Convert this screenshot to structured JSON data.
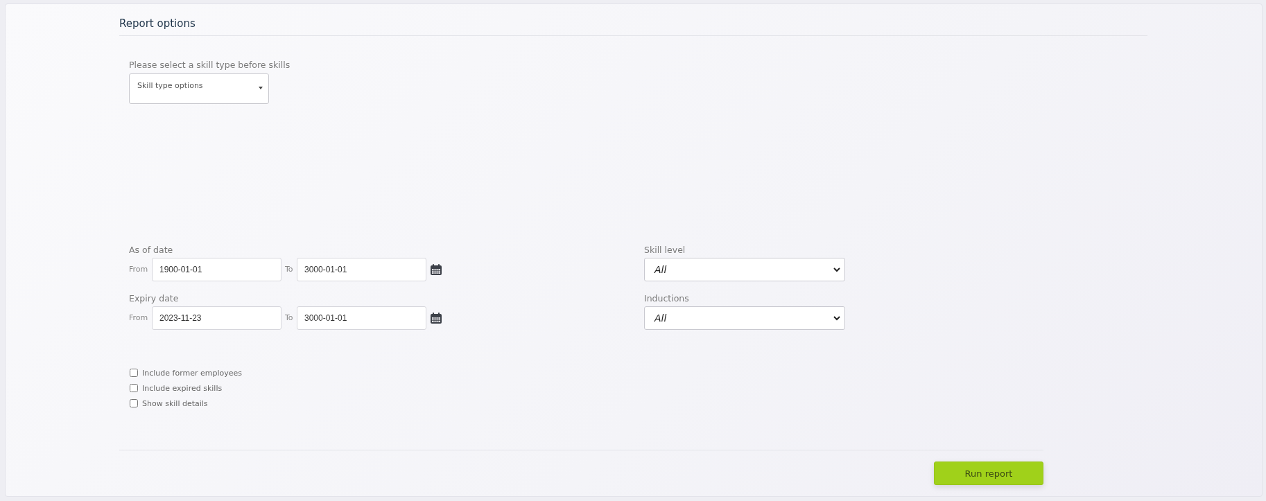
{
  "section": {
    "title": "Report options"
  },
  "skill_type": {
    "label": "Please select a skill type before skills",
    "placeholder": "Skill type options"
  },
  "date_ranges": [
    {
      "label": "As of date",
      "from_label": "From",
      "from_value": "1900-01-01",
      "to_label": "To",
      "to_value": "3000-01-01"
    },
    {
      "label": "Expiry date",
      "from_label": "From",
      "from_value": "2023-11-23",
      "to_label": "To",
      "to_value": "3000-01-01"
    }
  ],
  "selects": [
    {
      "label": "Skill level",
      "value": "All"
    },
    {
      "label": "Inductions",
      "value": "All"
    }
  ],
  "checkboxes": [
    {
      "label": "Include former employees",
      "checked": false
    },
    {
      "label": "Include expired skills",
      "checked": false
    },
    {
      "label": "Show skill details",
      "checked": false
    }
  ],
  "buttons": [
    {
      "label": "Run report"
    }
  ]
}
